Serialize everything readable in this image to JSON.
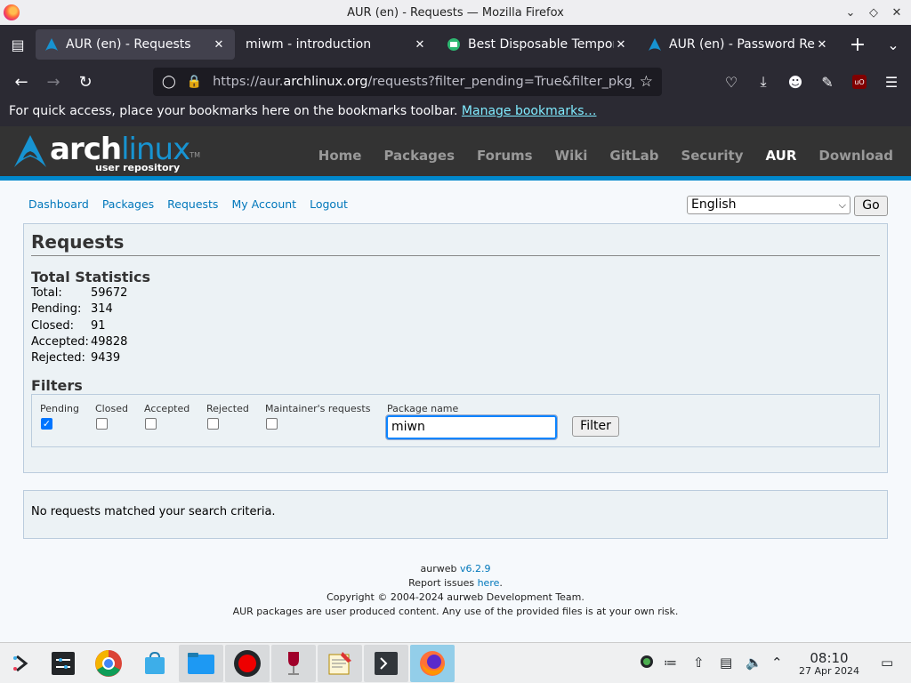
{
  "window": {
    "title": "AUR (en) - Requests — Mozilla Firefox"
  },
  "tabs": [
    {
      "title": "AUR (en) - Requests",
      "active": true
    },
    {
      "title": "miwm - introduction",
      "active": false
    },
    {
      "title": "Best Disposable Tempora",
      "active": false
    },
    {
      "title": "AUR (en) - Password Rese",
      "active": false
    }
  ],
  "urlbar": {
    "prefix": "https://aur.",
    "domain": "archlinux.org",
    "rest": "/requests?filter_pending=True&filter_pkg_na"
  },
  "bookmarks": {
    "message": "For quick access, place your bookmarks here on the bookmarks toolbar. ",
    "link": "Manage bookmarks…"
  },
  "arch": {
    "logo_arch": "arch",
    "logo_linux": "linux",
    "logo_sub": "user repository",
    "logo_tm": "TM",
    "nav": [
      "Home",
      "Packages",
      "Forums",
      "Wiki",
      "GitLab",
      "Security",
      "AUR",
      "Download"
    ]
  },
  "subnav": [
    "Dashboard",
    "Packages",
    "Requests",
    "My Account",
    "Logout"
  ],
  "language": {
    "selected": "English",
    "go_label": "Go"
  },
  "requests": {
    "heading": "Requests",
    "stats_heading": "Total Statistics",
    "stats": [
      {
        "label": "Total:",
        "value": "59672"
      },
      {
        "label": "Pending:",
        "value": "314"
      },
      {
        "label": "Closed:",
        "value": "91"
      },
      {
        "label": "Accepted:",
        "value": "49828"
      },
      {
        "label": "Rejected:",
        "value": "9439"
      }
    ],
    "filters_heading": "Filters",
    "filters": {
      "pending": "Pending",
      "closed": "Closed",
      "accepted": "Accepted",
      "rejected": "Rejected",
      "maintainer": "Maintainer's requests",
      "pkg_label": "Package name",
      "pkg_value": "miwn",
      "button": "Filter"
    },
    "no_results": "No requests matched your search criteria."
  },
  "footer": {
    "aurweb": "aurweb ",
    "version": "v6.2.9",
    "report": "Report issues ",
    "here": "here",
    "dot": ".",
    "copyright": "Copyright © 2004-2024 aurweb Development Team.",
    "disclaimer": "AUR packages are user produced content. Any use of the provided files is at your own risk."
  },
  "taskbar": {
    "time": "08:10",
    "date": "27 Apr 2024"
  },
  "colors": {
    "arch_blue": "#1793d1",
    "link": "#07b",
    "header_bg": "#333333"
  }
}
